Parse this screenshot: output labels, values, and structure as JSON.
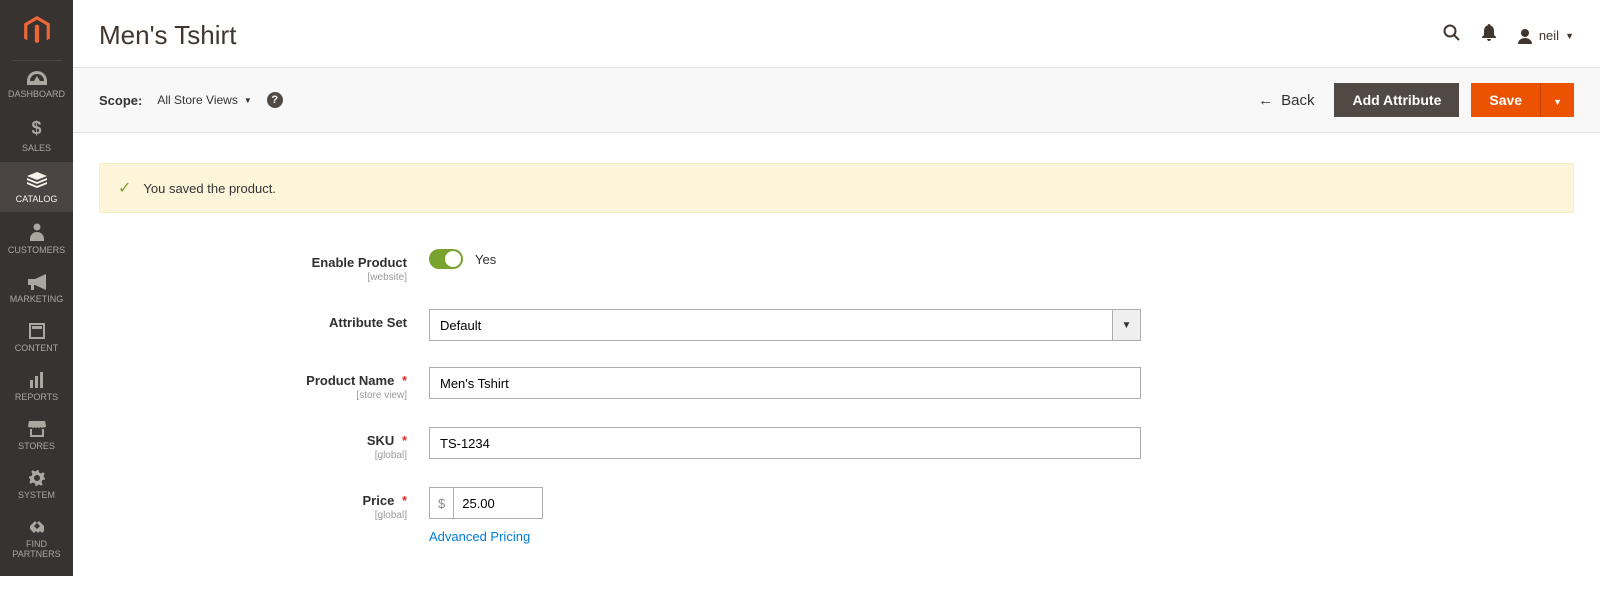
{
  "sidebar": {
    "items": [
      {
        "label": "DASHBOARD",
        "icon": "dashboard-icon"
      },
      {
        "label": "SALES",
        "icon": "dollar-icon"
      },
      {
        "label": "CATALOG",
        "icon": "catalog-icon"
      },
      {
        "label": "CUSTOMERS",
        "icon": "customers-icon"
      },
      {
        "label": "MARKETING",
        "icon": "marketing-icon"
      },
      {
        "label": "CONTENT",
        "icon": "content-icon"
      },
      {
        "label": "REPORTS",
        "icon": "reports-icon"
      },
      {
        "label": "STORES",
        "icon": "stores-icon"
      },
      {
        "label": "SYSTEM",
        "icon": "system-icon"
      },
      {
        "label": "FIND PARTNERS",
        "icon": "partners-icon"
      }
    ],
    "active_index": 2
  },
  "header": {
    "title": "Men's Tshirt",
    "account_name": "neil"
  },
  "toolbar": {
    "scope_label": "Scope:",
    "scope_value": "All Store Views",
    "back_label": "Back",
    "add_attribute_label": "Add Attribute",
    "save_label": "Save"
  },
  "message": {
    "text": "You saved the product."
  },
  "form": {
    "enable_product": {
      "label": "Enable Product",
      "scope": "[website]",
      "value_label": "Yes"
    },
    "attribute_set": {
      "label": "Attribute Set",
      "value": "Default"
    },
    "product_name": {
      "label": "Product Name",
      "scope": "[store view]",
      "value": "Men's Tshirt"
    },
    "sku": {
      "label": "SKU",
      "scope": "[global]",
      "value": "TS-1234"
    },
    "price": {
      "label": "Price",
      "scope": "[global]",
      "currency": "$",
      "value": "25.00",
      "advanced_link": "Advanced Pricing"
    }
  }
}
